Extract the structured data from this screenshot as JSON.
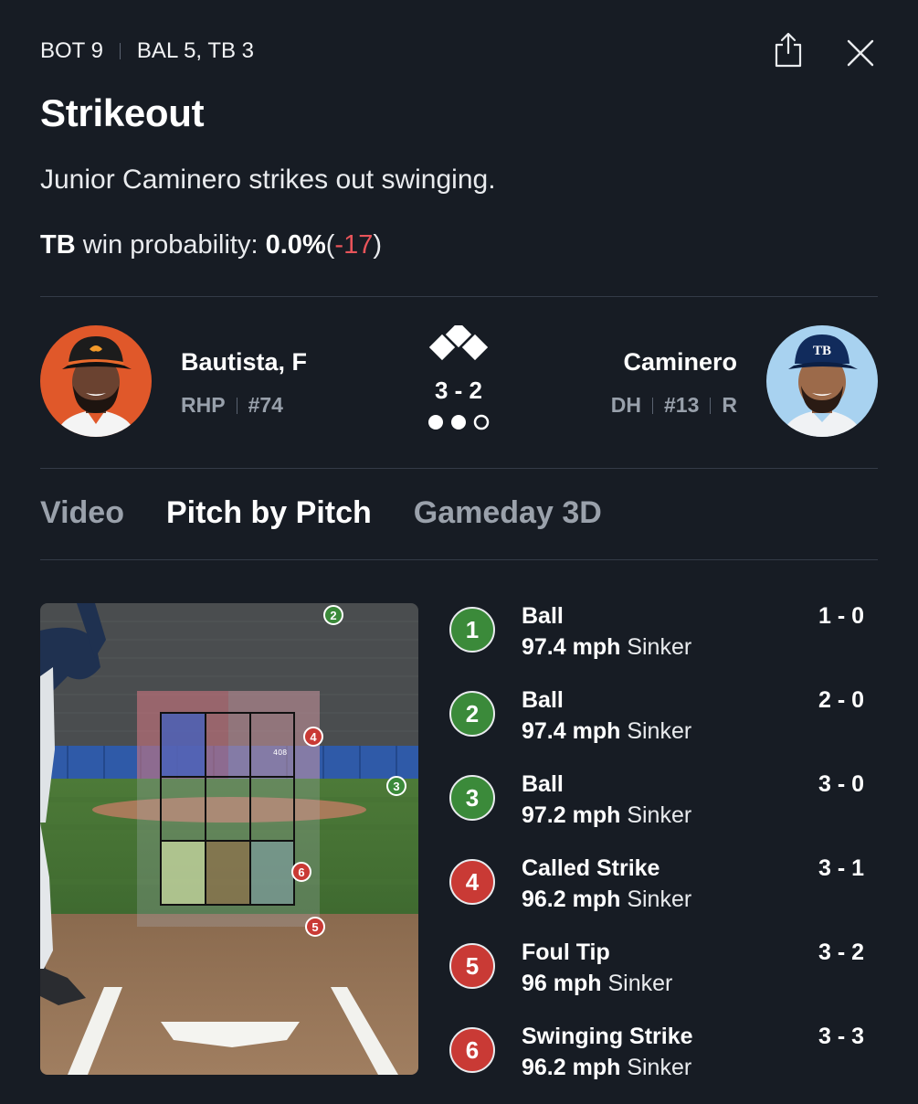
{
  "header": {
    "inning": "BOT 9",
    "score": "BAL 5, TB 3",
    "share_icon": "share-icon",
    "close_icon": "close-icon"
  },
  "play": {
    "title": "Strikeout",
    "description": "Junior Caminero strikes out swinging.",
    "win_probability": {
      "team": "TB",
      "label": "win probability:",
      "value": "0.0%",
      "paren_open": "(",
      "change": "-17",
      "paren_close": ")",
      "change_color": "#e8545a"
    }
  },
  "matchup": {
    "pitcher": {
      "name": "Bautista, F",
      "position": "RHP",
      "number": "#74"
    },
    "count": "3 - 2",
    "outs": [
      true,
      true,
      false
    ],
    "batter": {
      "name": "Caminero",
      "position": "DH",
      "number": "#13",
      "bats": "R"
    }
  },
  "tabs": [
    {
      "label": "Video",
      "active": false
    },
    {
      "label": "Pitch by Pitch",
      "active": true
    },
    {
      "label": "Gameday 3D",
      "active": false
    }
  ],
  "strike_zone": {
    "scoreboard_text": "408"
  },
  "pitches": [
    {
      "number": "1",
      "result": "Ball",
      "speed": "97.4 mph",
      "type": "Sinker",
      "count": "1 - 0",
      "color": "#3b8a3a"
    },
    {
      "number": "2",
      "result": "Ball",
      "speed": "97.4 mph",
      "type": "Sinker",
      "count": "2 - 0",
      "color": "#3b8a3a"
    },
    {
      "number": "3",
      "result": "Ball",
      "speed": "97.2 mph",
      "type": "Sinker",
      "count": "3 - 0",
      "color": "#3b8a3a"
    },
    {
      "number": "4",
      "result": "Called Strike",
      "speed": "96.2 mph",
      "type": "Sinker",
      "count": "3 - 1",
      "color": "#c93a35"
    },
    {
      "number": "5",
      "result": "Foul Tip",
      "speed": "96 mph",
      "type": "Sinker",
      "count": "3 - 2",
      "color": "#c93a35"
    },
    {
      "number": "6",
      "result": "Swinging Strike",
      "speed": "96.2 mph",
      "type": "Sinker",
      "count": "3 - 3",
      "color": "#c93a35"
    }
  ]
}
